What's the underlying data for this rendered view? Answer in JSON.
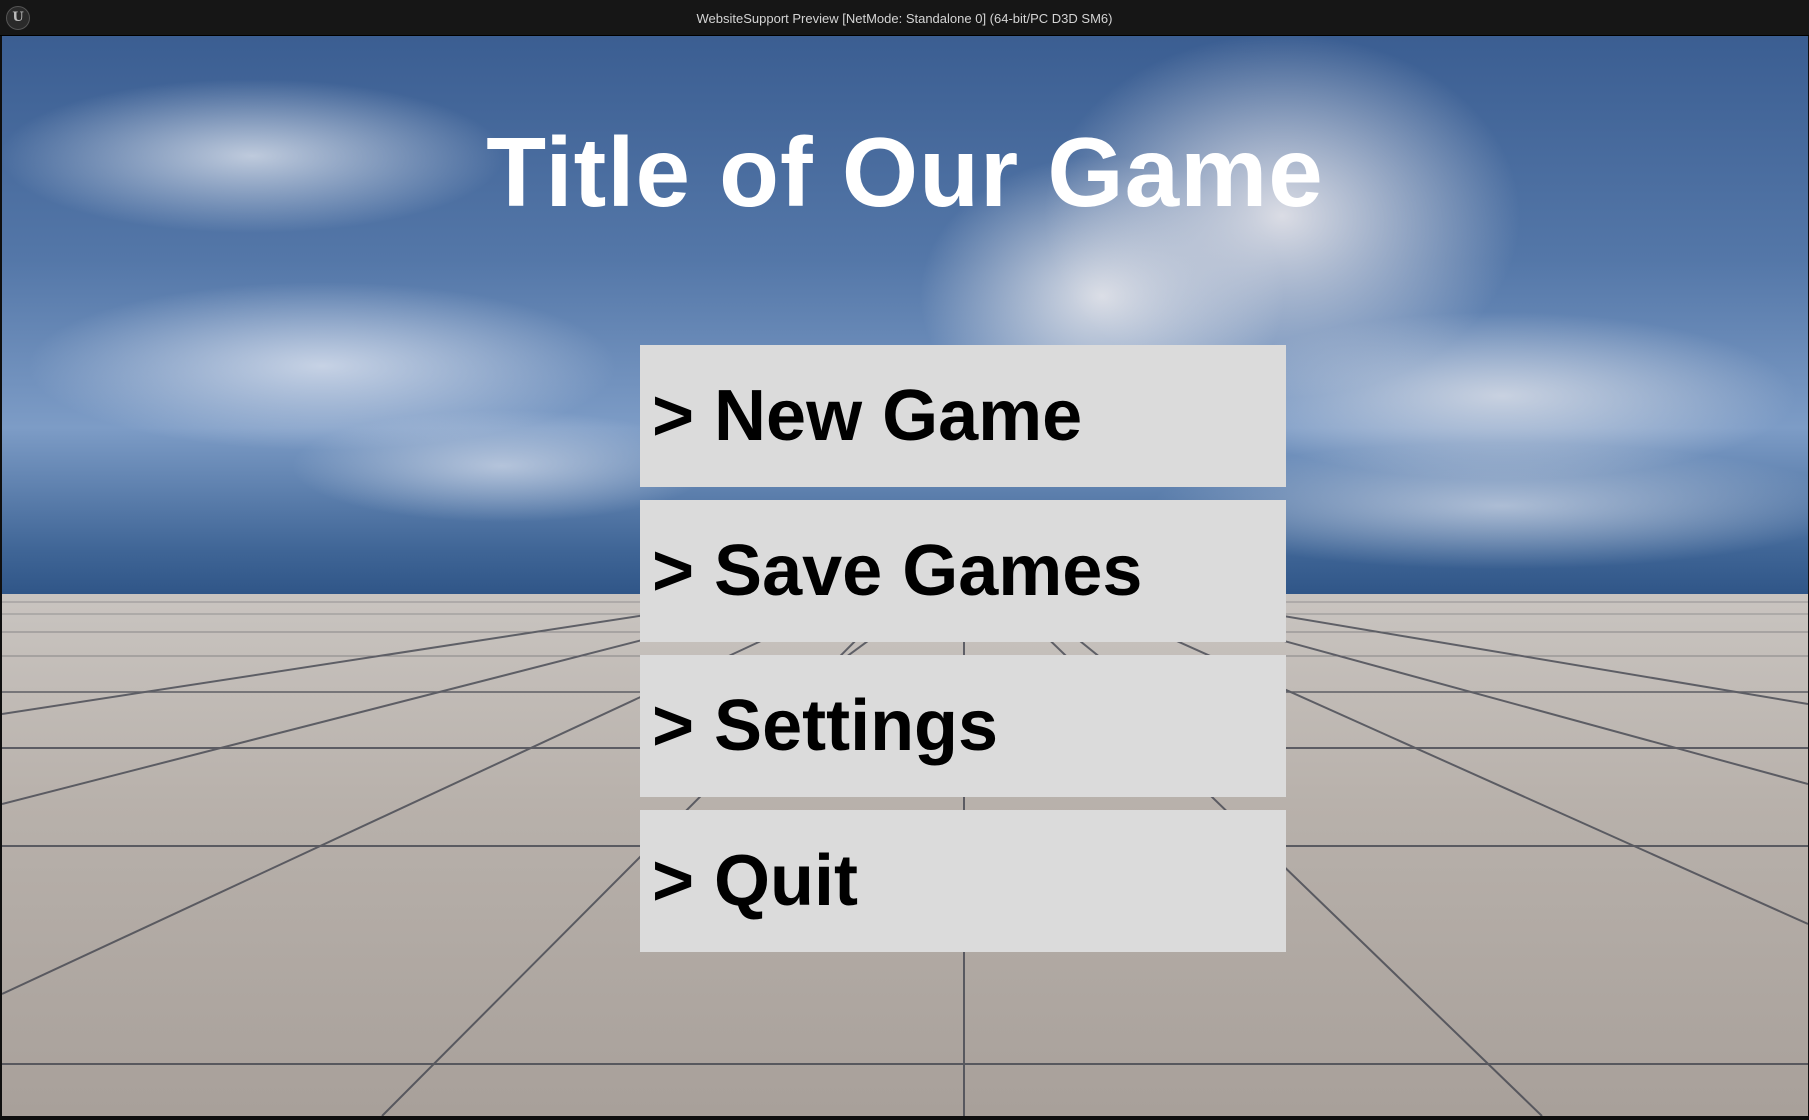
{
  "window": {
    "title": "WebsiteSupport Preview [NetMode: Standalone 0]  (64-bit/PC D3D SM6)",
    "logo_text": "U"
  },
  "game": {
    "title": "Title of Our Game",
    "menu": [
      {
        "label": "> New Game"
      },
      {
        "label": "> Save Games"
      },
      {
        "label": "> Settings"
      },
      {
        "label": "> Quit"
      }
    ]
  },
  "colors": {
    "button_bg": "#dbdbdb",
    "button_text": "#000000",
    "title_text": "#ffffff"
  }
}
